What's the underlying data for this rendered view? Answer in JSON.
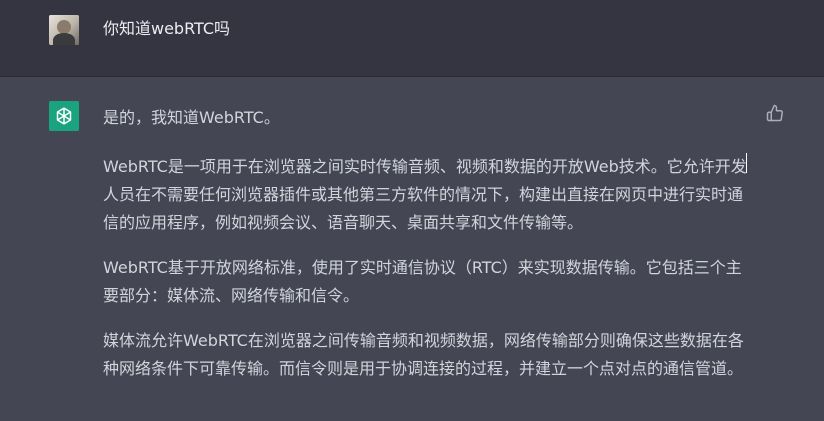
{
  "user_message": {
    "text": "你知道webRTC吗"
  },
  "assistant_message": {
    "paragraphs": [
      "是的，我知道WebRTC。",
      "WebRTC是一项用于在浏览器之间实时传输音频、视频和数据的开放Web技术。它允许开发人员在不需要任何浏览器插件或其他第三方软件的情况下，构建出直接在网页中进行实时通信的应用程序，例如视频会议、语音聊天、桌面共享和文件传输等。",
      "WebRTC基于开放网络标准，使用了实时通信协议（RTC）来实现数据传输。它包括三个主要部分：媒体流、网络传输和信令。",
      "媒体流允许WebRTC在浏览器之间传输音频和视频数据，网络传输部分则确保这些数据在各种网络条件下可靠传输。而信令则是用于协调连接的过程，并建立一个点对点的通信管道。"
    ]
  },
  "icons": {
    "user_avatar": "user-avatar-photo",
    "assistant_avatar": "openai-logo-icon",
    "feedback": "thumbs-up-icon"
  },
  "colors": {
    "user_row_bg": "#343541",
    "assistant_row_bg": "#444654",
    "assistant_avatar_bg": "#19a37f",
    "text": "#d1d5db"
  }
}
